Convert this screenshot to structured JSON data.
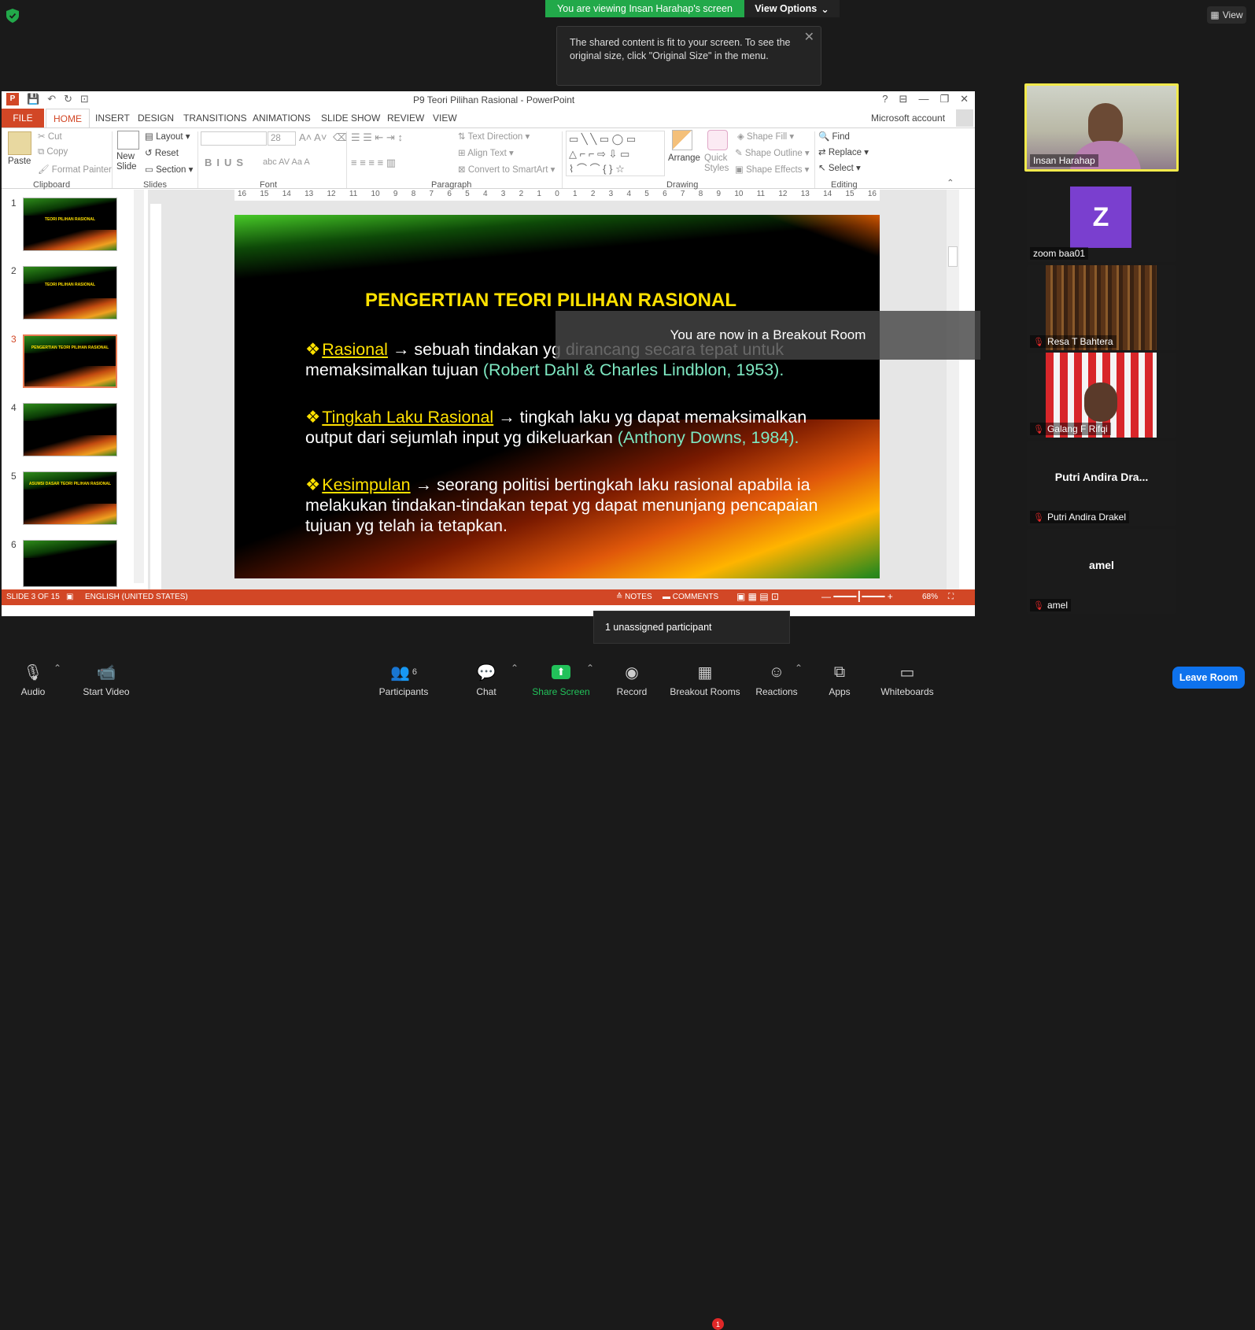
{
  "zoom": {
    "viewing_banner": "You are viewing Insan Harahap's screen",
    "view_options": "View Options",
    "view_button": "View",
    "tooltip_text": "The shared content is fit to your screen. To see the original size, click \"Original Size\" in the menu.",
    "breakout_message": "You are now in a Breakout Room",
    "unassigned": "1 unassigned participant",
    "leave_room": "Leave Room"
  },
  "ppt": {
    "title": "P9 Teori Pilihan Rasional - PowerPoint",
    "tabs": [
      "FILE",
      "HOME",
      "INSERT",
      "DESIGN",
      "TRANSITIONS",
      "ANIMATIONS",
      "SLIDE SHOW",
      "REVIEW",
      "VIEW"
    ],
    "account": "Microsoft account",
    "ribbon": {
      "paste": "Paste",
      "cut": "Cut",
      "copy": "Copy",
      "format_painter": "Format Painter",
      "clipboard": "Clipboard",
      "new_slide": "New Slide",
      "layout": "Layout",
      "reset": "Reset",
      "section": "Section",
      "slides": "Slides",
      "font_size": "28",
      "font": "Font",
      "text_direction": "Text Direction",
      "align_text": "Align Text",
      "convert_smartart": "Convert to SmartArt",
      "paragraph": "Paragraph",
      "arrange": "Arrange",
      "quick_styles": "Quick Styles",
      "shape_fill": "Shape Fill",
      "shape_outline": "Shape Outline",
      "shape_effects": "Shape Effects",
      "drawing": "Drawing",
      "find": "Find",
      "replace": "Replace",
      "select": "Select",
      "editing": "Editing"
    },
    "ruler_numbers": [
      "16",
      "15",
      "14",
      "13",
      "12",
      "11",
      "10",
      "9",
      "8",
      "7",
      "6",
      "5",
      "4",
      "3",
      "2",
      "1",
      "0",
      "1",
      "2",
      "3",
      "4",
      "5",
      "6",
      "7",
      "8",
      "9",
      "10",
      "11",
      "12",
      "13",
      "14",
      "15",
      "16"
    ],
    "thumbnails": [
      {
        "num": "1",
        "title": "TEORI PILIHAN RASIONAL"
      },
      {
        "num": "2",
        "title": "TEORI PILIHAN RASIONAL"
      },
      {
        "num": "3",
        "title": "PENGERTIAN TEORI PILIHAN RASIONAL"
      },
      {
        "num": "4",
        "title": ""
      },
      {
        "num": "5",
        "title": "ASUMSI DASAR TEORI PILIHAN RASIONAL"
      },
      {
        "num": "6",
        "title": ""
      }
    ],
    "slide": {
      "title": "PENGERTIAN TEORI PILIHAN RASIONAL",
      "b1_kw": "Rasional",
      "b1_text": " sebuah tindakan yg dirancang secara tepat untuk memaksimalkan tujuan ",
      "b1_ref": "(Robert Dahl & Charles Lindblon, 1953).",
      "b2_kw": "Tingkah Laku Rasional",
      "b2_text": " tingkah laku yg dapat memaksimalkan output dari sejumlah input yg dikeluarkan ",
      "b2_ref": "(Anthony Downs, 1984).",
      "b3_kw": "Kesimpulan",
      "b3_text": " seorang politisi bertingkah laku rasional apabila ia melakukan tindakan-tindakan tepat yg dapat menunjang pencapaian tujuan yg telah ia tetapkan."
    },
    "status": {
      "slide_of": "SLIDE 3 OF 15",
      "language": "ENGLISH (UNITED STATES)",
      "notes": "NOTES",
      "comments": "COMMENTS",
      "zoom": "68%"
    }
  },
  "participants": [
    {
      "name": "Insan Harahap"
    },
    {
      "name": "zoom baa01",
      "initial": "Z"
    },
    {
      "name": "Resa T Bahtera"
    },
    {
      "name": "Galang F Rifqi"
    },
    {
      "name": "Putri Andira Drakel",
      "display": "Putri Andira Dra..."
    },
    {
      "name": "amel",
      "display": "amel"
    }
  ],
  "toolbar": {
    "audio": "Audio",
    "start_video": "Start Video",
    "participants": "Participants",
    "participants_count": "6",
    "chat": "Chat",
    "share_screen": "Share Screen",
    "record": "Record",
    "breakout_rooms": "Breakout Rooms",
    "breakout_badge": "1",
    "reactions": "Reactions",
    "apps": "Apps",
    "whiteboards": "Whiteboards"
  },
  "colors": {
    "zoom_green": "#22a94a",
    "ppt_orange": "#d24726",
    "slide_yellow": "#ffe100",
    "ref_cyan": "#7ee8c2",
    "leave_blue": "#0e72ed"
  }
}
